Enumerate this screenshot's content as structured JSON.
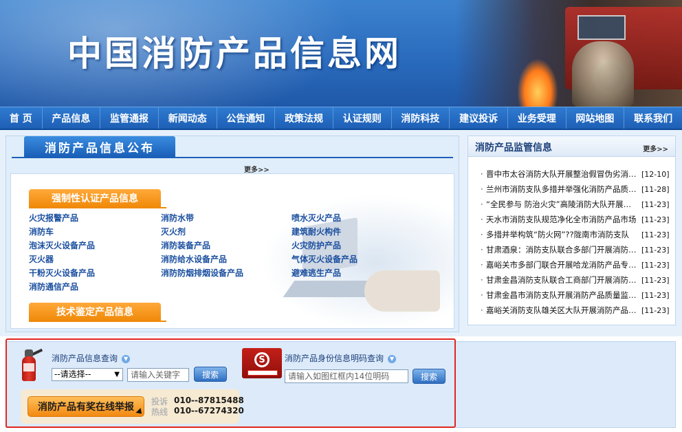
{
  "header": {
    "site_title": "中国消防产品信息网"
  },
  "nav": {
    "items": [
      "首 页",
      "产品信息",
      "监管通报",
      "新闻动态",
      "公告通知",
      "政策法规",
      "认证规则",
      "消防科技",
      "建议投诉",
      "业务受理",
      "网站地图",
      "联系我们"
    ]
  },
  "publish": {
    "title": "消防产品信息公布",
    "more": "更多>>",
    "cert_title": "强制性认证产品信息",
    "tech_title": "技术鉴定产品信息",
    "products": [
      "火灾报警产品",
      "消防水带",
      "喷水灭火产品",
      "消防车",
      "灭火剂",
      "建筑耐火构件",
      "泡沫灭火设备产品",
      "消防装备产品",
      "火灾防护产品",
      "灭火器",
      "消防给水设备产品",
      "气体灭火设备产品",
      "干粉灭火设备产品",
      "消防防烟排烟设备产品",
      "避难逃生产品",
      "消防通信产品"
    ]
  },
  "supervision": {
    "title": "消防产品监管信息",
    "more": "更多>>",
    "news": [
      {
        "title": "晋中市太谷消防大队开展整治假冒伪劣消防产品",
        "date": "[12-10]"
      },
      {
        "title": "兰州市消防支队多措并举强化消防产品质量监管",
        "date": "[11-28]"
      },
      {
        "title": "“全民参与 防治火灾”高陵消防大队开展宣传",
        "date": "[11-23]"
      },
      {
        "title": "天水市消防支队规范净化全市消防产品市场",
        "date": "[11-23]"
      },
      {
        "title": "多措并举构筑“防火网”??陇南市消防支队",
        "date": "[11-23]"
      },
      {
        "title": "甘肃酒泉：消防支队联合多部门开展消防产品检查",
        "date": "[11-23]"
      },
      {
        "title": "嘉峪关市多部门联合开展哈龙消防产品专项检查",
        "date": "[11-23]"
      },
      {
        "title": "甘肃金昌消防支队联合工商部门开展消防产品检查",
        "date": "[11-23]"
      },
      {
        "title": "甘肃金昌市消防支队开展消防产品质量监督抽查",
        "date": "[11-23]"
      },
      {
        "title": "嘉峪关消防支队雄关区大队开展消防产品检查",
        "date": "[11-23]"
      }
    ]
  },
  "query": {
    "info_query_label": "消防产品信息查询",
    "select_value": "--请选择--",
    "keyword_placeholder": "请输入关键字",
    "search_label": "搜索",
    "id_query_label": "消防产品身份信息明码查询",
    "code_placeholder": "请输入如图红框内14位明码",
    "report_label": "消防产品有奖在线举报",
    "complaint_label": "投诉",
    "complaint_phone": "010--87815488",
    "hotline_label": "热线",
    "hotline_phone": "010--67274320"
  },
  "colors": {
    "nav_blue": "#1d5fb5",
    "accent_orange": "#f08a0a",
    "highlight_red": "#e0261f"
  }
}
